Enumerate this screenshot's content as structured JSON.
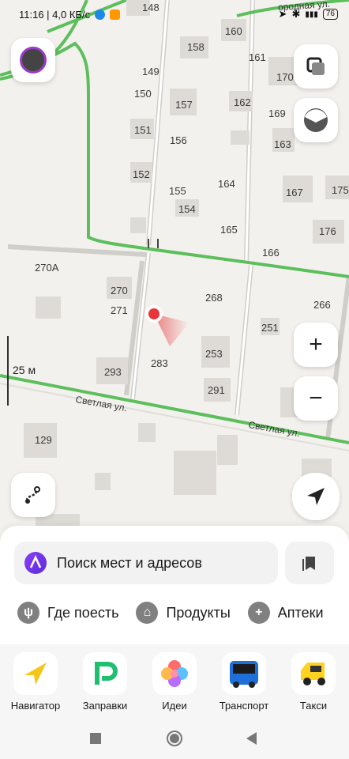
{
  "status_bar": {
    "time_speed": "11:16 | 4,0 КБ/с",
    "battery": "76"
  },
  "map": {
    "house_numbers": [
      "148",
      "160",
      "161",
      "158",
      "149",
      "170",
      "150",
      "157",
      "162",
      "169",
      "151",
      "156",
      "163",
      "152",
      "155",
      "164",
      "167",
      "175",
      "154",
      "165",
      "176",
      "166",
      "270А",
      "270",
      "268",
      "271",
      "266",
      "251",
      "283",
      "253",
      "293",
      "291",
      "129"
    ],
    "streets": {
      "svetlaya_1": "Светлая ул.",
      "svetlaya_2": "Светлая ул.",
      "top_right": "ородная ул."
    },
    "scale_label": "25 м",
    "colors": {
      "road_green": "#5cbf5c",
      "location_red": "#e8353a"
    }
  },
  "sheet": {
    "search_placeholder": "Поиск мест и адресов",
    "categories": [
      {
        "label": "Где поесть",
        "icon": "fork-knife-icon"
      },
      {
        "label": "Продукты",
        "icon": "basket-icon"
      },
      {
        "label": "Аптеки",
        "icon": "plus-icon"
      }
    ]
  },
  "dock": {
    "apps": [
      {
        "label": "Навигатор",
        "icon": "navigator-arrow-icon"
      },
      {
        "label": "Заправки",
        "icon": "fuel-p-icon"
      },
      {
        "label": "Идеи",
        "icon": "ideas-flower-icon"
      },
      {
        "label": "Транспорт",
        "icon": "bus-icon"
      },
      {
        "label": "Такси",
        "icon": "taxi-icon"
      }
    ]
  }
}
